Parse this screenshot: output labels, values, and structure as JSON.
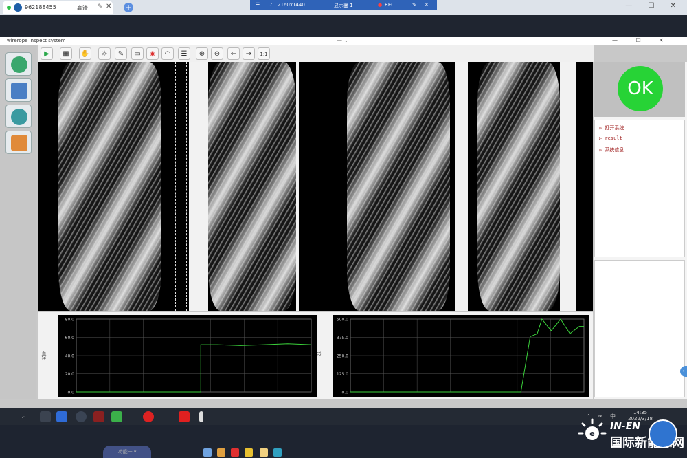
{
  "browser": {
    "tab_id": "962188455",
    "tab_quality": "高清",
    "new_tab_symbol": "+",
    "window_controls": "— ☐ ✕"
  },
  "remote_bar": {
    "resolution": "2160x1440",
    "display": "显示器 1",
    "rec": "REC"
  },
  "app": {
    "title": "wirerope inspect system",
    "window_controls": "— ☐ ✕",
    "menu_symbol": "— ⌄"
  },
  "toolbar": {
    "buttons": [
      {
        "icon": "play-icon",
        "glyph": "▶"
      },
      {
        "icon": "grid-icon",
        "glyph": "▦"
      },
      {
        "icon": "hand-icon",
        "glyph": "✋"
      },
      {
        "icon": "bulb-icon",
        "glyph": "☼"
      },
      {
        "icon": "tag-icon",
        "glyph": "✎"
      },
      {
        "icon": "monitor-icon",
        "glyph": "▭"
      },
      {
        "icon": "record-icon",
        "glyph": "◉"
      },
      {
        "icon": "gauge-icon",
        "glyph": "◠"
      },
      {
        "icon": "table-icon",
        "glyph": "☰"
      },
      {
        "icon": "zoom-in-icon",
        "glyph": "⊕"
      },
      {
        "icon": "zoom-out-icon",
        "glyph": "⊖"
      },
      {
        "icon": "arrow-left-icon",
        "glyph": "←"
      },
      {
        "icon": "arrow-right-icon",
        "glyph": "→"
      },
      {
        "icon": "fit-icon",
        "glyph": "1:1"
      }
    ]
  },
  "sidebar": {
    "buttons": [
      {
        "icon": "document-icon",
        "color": "#3aa76d"
      },
      {
        "icon": "user-icon",
        "color": "#4b7fc4"
      },
      {
        "icon": "settings-icon",
        "color": "#3a9aa0"
      },
      {
        "icon": "lock-icon",
        "color": "#e08a3a"
      }
    ]
  },
  "status": {
    "ok_label": "OK",
    "ok_color": "#27d336"
  },
  "tree": {
    "items": [
      "▷ 打开系统",
      "▷ result",
      "▷ 系统信息"
    ]
  },
  "chart_data": [
    {
      "type": "line",
      "ylabel": "直径",
      "ylim": [
        0,
        80
      ],
      "yticks": [
        "80.0",
        "60.0",
        "40.0",
        "20.0",
        "0.0"
      ],
      "grid": true,
      "series": [
        {
          "color": "#3bd23b",
          "x": [
            0,
            0.53,
            0.53,
            0.6,
            0.7,
            0.8,
            0.9,
            1.0
          ],
          "values": [
            0,
            0,
            52,
            52,
            51,
            52,
            53,
            52
          ]
        }
      ]
    },
    {
      "type": "line",
      "ylabel": "比",
      "ylim": [
        0,
        500
      ],
      "yticks": [
        "500.0",
        "375.0",
        "250.0",
        "125.0",
        "0.0"
      ],
      "grid": true,
      "series": [
        {
          "color": "#3bd23b",
          "x": [
            0,
            0.73,
            0.73,
            0.77,
            0.8,
            0.82,
            0.86,
            0.9,
            0.94,
            0.98,
            1.0
          ],
          "values": [
            0,
            0,
            0,
            380,
            400,
            500,
            420,
            500,
            400,
            450,
            450
          ]
        }
      ]
    }
  ],
  "taskbar": {
    "time": "14:35",
    "date": "2022/3/18",
    "tray": "⌃ ✉ 中"
  },
  "local_bar": {
    "ghost_tab": "功能一 ▾"
  },
  "watermark": {
    "line1": "IN-EN",
    "line2": "国际新能源网"
  }
}
